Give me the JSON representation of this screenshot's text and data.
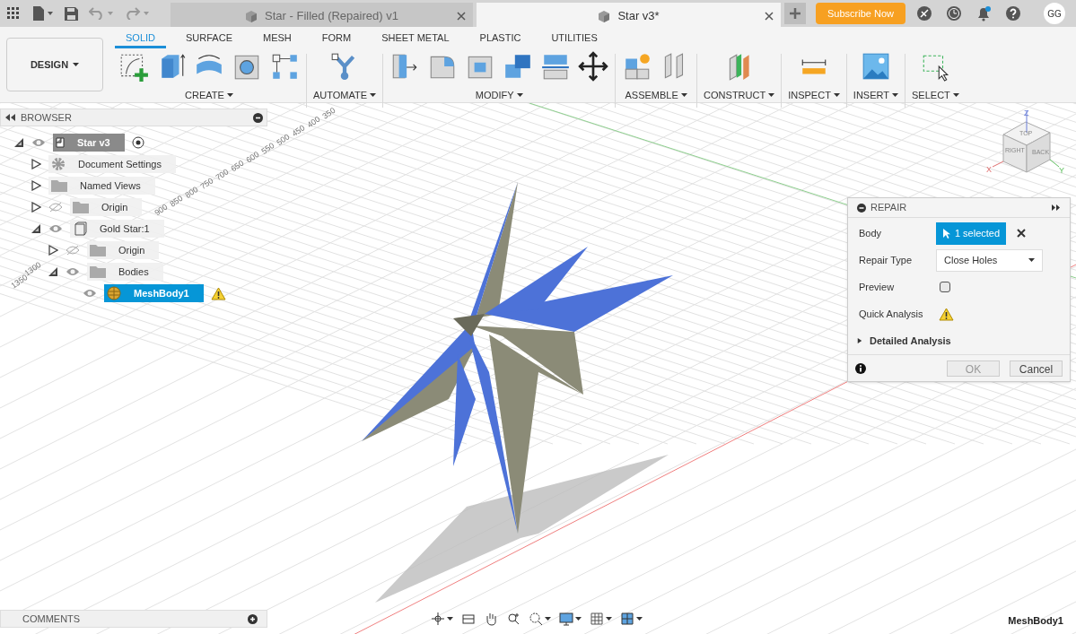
{
  "topbar": {
    "doc_tabs": [
      {
        "title": "Star - Filled (Repaired) v1",
        "selected": false
      },
      {
        "title": "Star v3*",
        "selected": true
      }
    ],
    "subscribe": "Subscribe Now",
    "notification": true,
    "avatar": "GG"
  },
  "workspace": {
    "label": "DESIGN"
  },
  "toolbar_tabs": [
    {
      "label": "SOLID",
      "selected": true
    },
    {
      "label": "SURFACE",
      "selected": false
    },
    {
      "label": "MESH",
      "selected": false
    },
    {
      "label": "FORM",
      "selected": false
    },
    {
      "label": "SHEET METAL",
      "selected": false
    },
    {
      "label": "PLASTIC",
      "selected": false
    },
    {
      "label": "UTILITIES",
      "selected": false
    }
  ],
  "tool_groups": [
    {
      "label": "CREATE",
      "tools": [
        {
          "kind": "sketch"
        },
        {
          "kind": "extrude"
        },
        {
          "kind": "revolve"
        },
        {
          "kind": "hole"
        },
        {
          "kind": "pattern"
        }
      ]
    },
    {
      "label": "AUTOMATE",
      "tools": [
        {
          "kind": "automate"
        }
      ]
    },
    {
      "label": "MODIFY",
      "tools": [
        {
          "kind": "presspull"
        },
        {
          "kind": "fillet"
        },
        {
          "kind": "shell"
        },
        {
          "kind": "combine"
        },
        {
          "kind": "split"
        },
        {
          "kind": "move"
        }
      ]
    },
    {
      "label": "ASSEMBLE",
      "tools": [
        {
          "kind": "component"
        },
        {
          "kind": "joint"
        }
      ]
    },
    {
      "label": "CONSTRUCT",
      "tools": [
        {
          "kind": "plane"
        }
      ]
    },
    {
      "label": "INSPECT",
      "tools": [
        {
          "kind": "measure"
        }
      ]
    },
    {
      "label": "INSERT",
      "tools": [
        {
          "kind": "image"
        }
      ]
    },
    {
      "label": "SELECT",
      "tools": [
        {
          "kind": "window"
        }
      ]
    }
  ],
  "browser": {
    "title": "BROWSER",
    "tree": [
      {
        "label": "Star v3",
        "kind": "document",
        "expanded": true,
        "visible": true,
        "active": true,
        "selected": false,
        "children": [
          {
            "label": "Document Settings",
            "kind": "settings",
            "expanded": false,
            "selected": false
          },
          {
            "label": "Named Views",
            "kind": "folder",
            "expanded": false,
            "selected": false
          },
          {
            "label": "Origin",
            "kind": "folder",
            "expanded": false,
            "visible": false,
            "selected": false
          },
          {
            "label": "Gold Star:1",
            "kind": "component",
            "expanded": true,
            "visible": true,
            "selected": false,
            "children": [
              {
                "label": "Origin",
                "kind": "folder",
                "expanded": false,
                "visible": false,
                "selected": false
              },
              {
                "label": "Bodies",
                "kind": "folder",
                "expanded": true,
                "visible": true,
                "selected": false,
                "children": [
                  {
                    "label": "MeshBody1",
                    "kind": "mesh",
                    "visible": true,
                    "warning": true,
                    "selected": true
                  }
                ]
              }
            ]
          }
        ]
      }
    ]
  },
  "ruler_labels": {
    "upper": [
      "350",
      "400",
      "450",
      "500",
      "550",
      "600",
      "650",
      "700",
      "750",
      "800",
      "850",
      "900"
    ],
    "lower": [
      "1300",
      "1350"
    ]
  },
  "viewcube": {
    "faces": [
      "TOP",
      "RIGHT",
      "BACK"
    ],
    "axes": [
      "Z",
      "X",
      "Y"
    ]
  },
  "repair_panel": {
    "title": "REPAIR",
    "rows": [
      {
        "kind": "selection",
        "label": "Body",
        "value": "1 selected"
      },
      {
        "kind": "dropdown",
        "label": "Repair Type",
        "value": "Close Holes"
      },
      {
        "kind": "checkbox",
        "label": "Preview",
        "checked": false
      },
      {
        "kind": "status",
        "label": "Quick Analysis",
        "warning": true
      },
      {
        "kind": "section",
        "label": "Detailed Analysis",
        "expanded": false
      }
    ],
    "buttons": [
      {
        "label": "OK",
        "disabled": true
      },
      {
        "label": "Cancel",
        "disabled": false
      }
    ]
  },
  "comments": {
    "title": "COMMENTS"
  },
  "nav_tools": [
    {
      "kind": "orbit",
      "has_menu": true
    },
    {
      "kind": "lookat",
      "has_menu": false
    },
    {
      "kind": "pan",
      "has_menu": false
    },
    {
      "kind": "zoom",
      "has_menu": false
    },
    {
      "kind": "fit",
      "has_menu": true
    },
    {
      "kind": "display",
      "has_menu": true
    },
    {
      "kind": "grid",
      "has_menu": true
    },
    {
      "kind": "viewports",
      "has_menu": true
    }
  ],
  "status_bar": {
    "selection": "MeshBody1"
  }
}
